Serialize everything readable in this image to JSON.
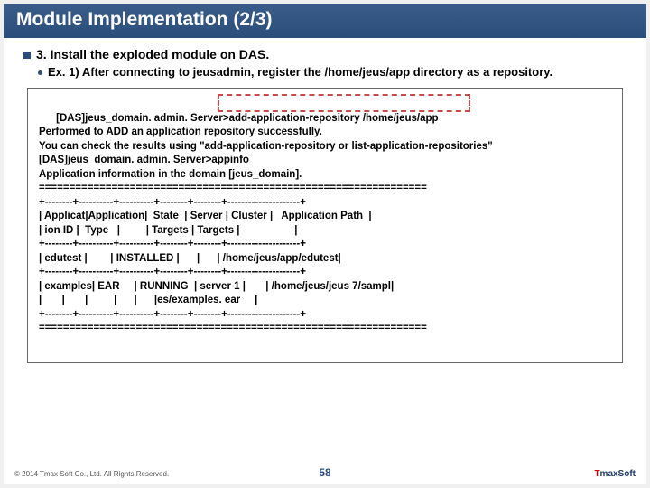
{
  "title": "Module Implementation (2/3)",
  "heading": "3. Install the exploded module on DAS.",
  "subheading": "Ex. 1) After connecting to jeusadmin, register the /home/jeus/app directory as a repository.",
  "code": "[DAS]jeus_domain. admin. Server>add-application-repository /home/jeus/app\nPerformed to ADD an application repository successfully.\nYou can check the results using \"add-application-repository or list-application-repositories\"\n[DAS]jeus_domain. admin. Server>appinfo\nApplication information in the domain [jeus_domain].\n================================================================\n+--------+----------+----------+--------+--------+---------------------+\n| Applicat|Application|  State  | Server | Cluster |   Application Path  |\n| ion ID |  Type   |         | Targets | Targets |                   |\n+--------+----------+----------+--------+--------+---------------------+\n| edutest |        | INSTALLED |      |      | /home/jeus/app/edutest|\n+--------+----------+----------+--------+--------+---------------------+\n| examples| EAR     | RUNNING  | server 1 |       | /home/jeus/jeus 7/sampl|\n|       |       |         |      |      |es/examples. ear     |\n+--------+----------+----------+--------+--------+---------------------+\n================================================================",
  "copyright": "© 2014 Tmax Soft Co., Ltd. All Rights Reserved.",
  "pageNumber": "58",
  "logo": {
    "t": "T",
    "rest": "maxSoft"
  }
}
